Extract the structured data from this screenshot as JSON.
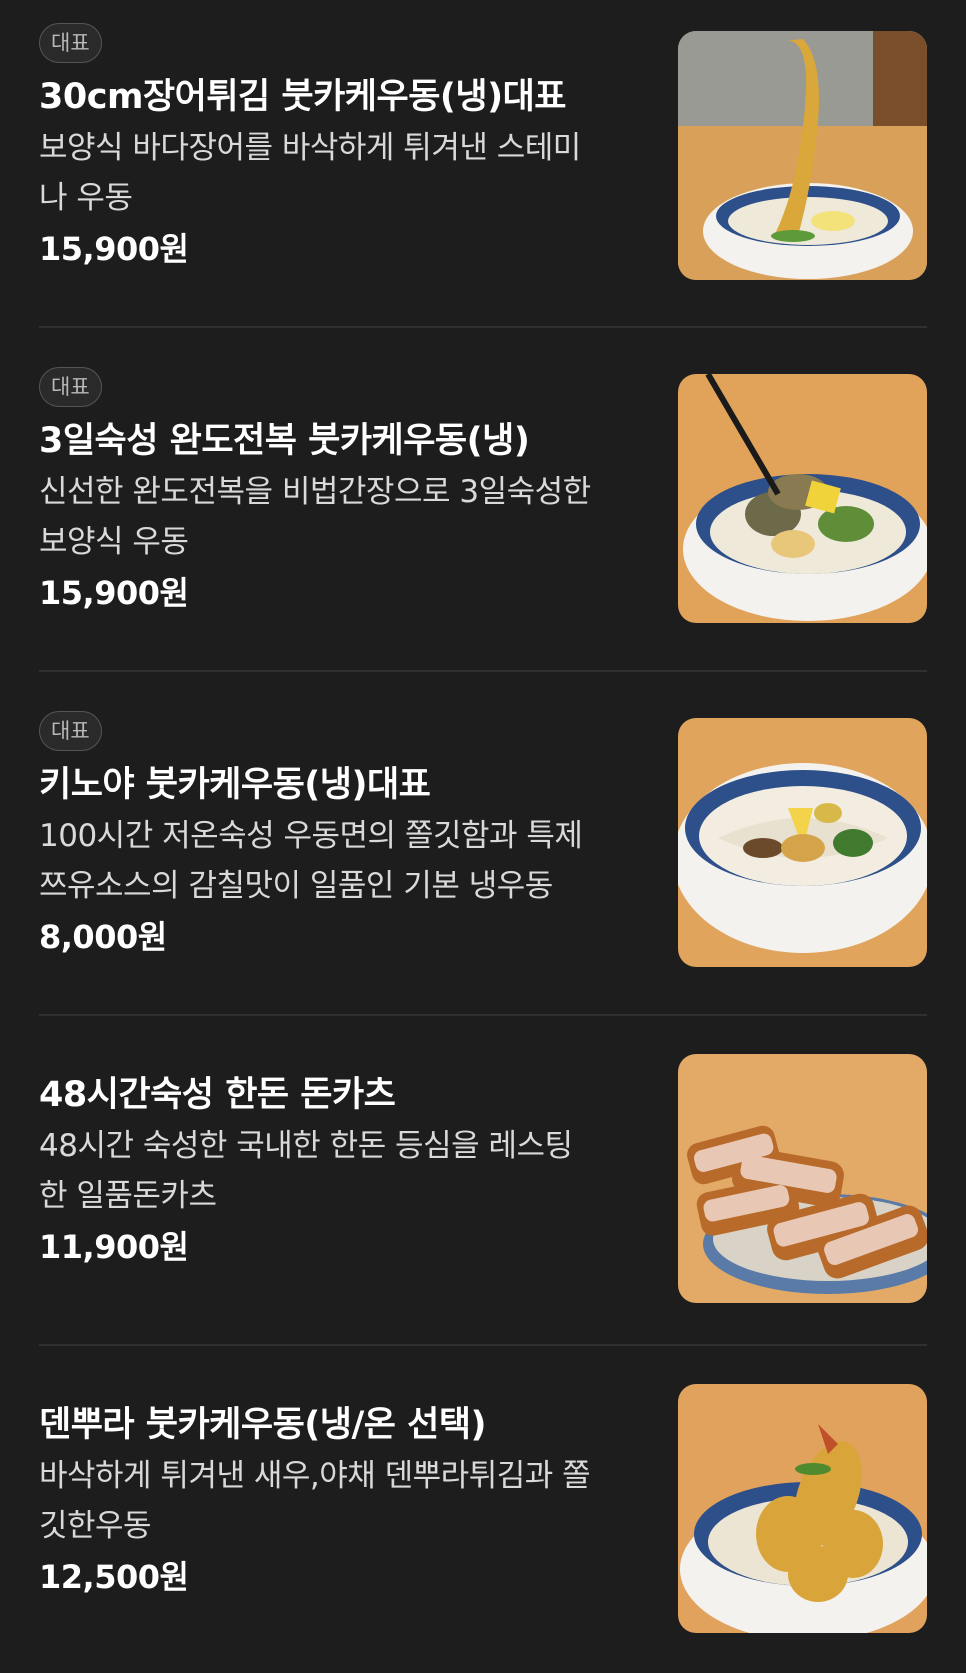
{
  "menu": {
    "items": [
      {
        "badge": "대표",
        "title": "30cm장어튀김 붓카케우동(냉)대표",
        "desc_line1": "보양식 바다장어를 바삭하게 튀겨낸 스테미",
        "desc_line2": "나 우동",
        "price": "15,900원",
        "image": "eel-tempura-udon-photo"
      },
      {
        "badge": "대표",
        "title": "3일숙성 완도전복 붓카케우동(냉)",
        "desc_line1": "신선한 완도전복을 비법간장으로 3일숙성한",
        "desc_line2": "보양식 우동",
        "price": "15,900원",
        "image": "abalone-udon-photo"
      },
      {
        "badge": "대표",
        "title": "키노야 붓카케우동(냉)대표",
        "desc_line1": "100시간 저온숙성 우동면의 쫄깃함과 특제",
        "desc_line2": "쯔유소스의 감칠맛이 일품인 기본 냉우동",
        "price": "8,000원",
        "image": "kinoya-udon-photo"
      },
      {
        "title": "48시간숙성 한돈 돈카츠",
        "desc_line1": "48시간 숙성한 국내한 한돈 등심을 레스팅",
        "desc_line2": "한 일품돈카츠",
        "price": "11,900원",
        "image": "pork-cutlet-photo"
      },
      {
        "title": "덴뿌라 붓카케우동(냉/온 선택)",
        "desc_line1": "바삭하게 튀겨낸 새우,야채 덴뿌라튀김과 쫄",
        "desc_line2": "깃한우동",
        "price": "12,500원",
        "image": "tempura-udon-photo"
      }
    ]
  },
  "colors": {
    "background": "#1d1d1d",
    "text": "#ffffff",
    "muted_text": "#d9d9d9",
    "badge_border": "#555555",
    "divider": "#2f2f2f"
  }
}
